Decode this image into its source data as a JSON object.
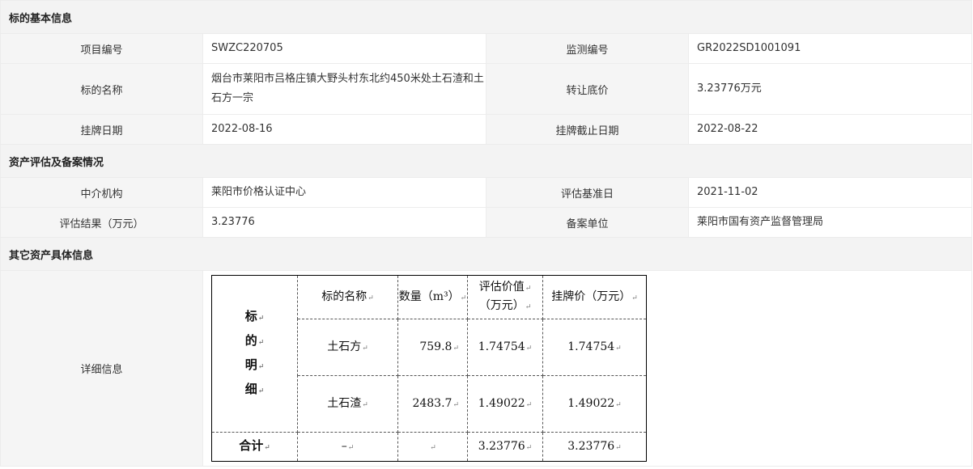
{
  "sections": {
    "basic_title": "标的基本信息",
    "asset_title": "资产评估及备案情况",
    "other_title": "其它资产具体信息"
  },
  "basic": {
    "project_no_label": "项目编号",
    "project_no": "SWZC220705",
    "monitor_no_label": "监测编号",
    "monitor_no": "GR2022SD1001091",
    "name_label": "标的名称",
    "name": "烟台市莱阳市吕格庄镇大野头村东北约450米处土石渣和土石方一宗",
    "price_label": "转让底价",
    "price": "3.23776万元",
    "list_date_label": "挂牌日期",
    "list_date": "2022-08-16",
    "end_date_label": "挂牌截止日期",
    "end_date": "2022-08-22"
  },
  "asset": {
    "agency_label": "中介机构",
    "agency": "莱阳市价格认证中心",
    "base_date_label": "评估基准日",
    "base_date": "2021-11-02",
    "result_label": "评估结果（万元）",
    "result": "3.23776",
    "filing_label": "备案单位",
    "filing": "莱阳市国有资产监督管理局"
  },
  "other": {
    "detail_label": "详细信息"
  },
  "detail_table": {
    "side_label": [
      "标",
      "的",
      "明",
      "细"
    ],
    "headers": {
      "name": "标的名称",
      "qty": "数量（m³）",
      "eval_line1": "评估价值",
      "eval_line2": "（万元）",
      "price": "挂牌价（万元）"
    },
    "rows": [
      {
        "name": "土石方",
        "qty": "759.8",
        "eval": "1.74754",
        "price": "1.74754"
      },
      {
        "name": "土石渣",
        "qty": "2483.7",
        "eval": "1.49022",
        "price": "1.49022"
      }
    ],
    "total": {
      "label": "合计",
      "name": "–",
      "qty": "",
      "eval": "3.23776",
      "price": "3.23776"
    }
  }
}
